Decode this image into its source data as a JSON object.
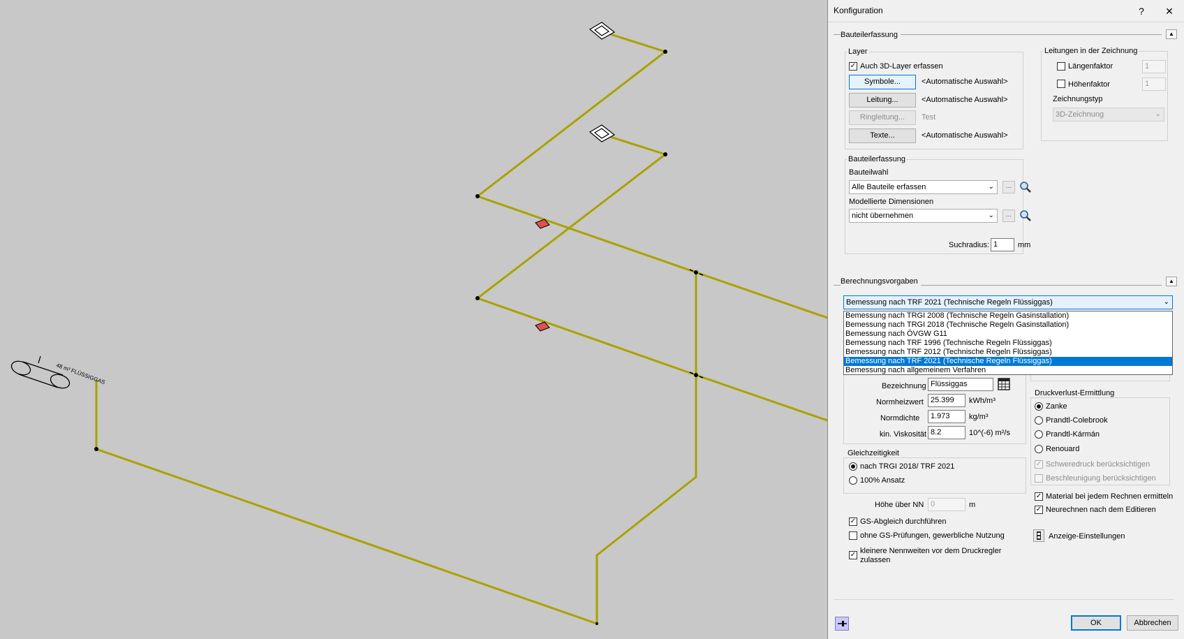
{
  "colors": {
    "pipe": "#a8a200",
    "accent": "#0078d7"
  },
  "canvas": {
    "labels": {
      "tank_label": "48 m³ FLÜSSIGGAS"
    }
  },
  "dialog": {
    "title": "Konfiguration",
    "help_label": "?",
    "close_label": "✕",
    "bauteilerfassung_section": {
      "heading": "Bauteilerfassung",
      "layer_group": {
        "label": "Layer",
        "check_3d_label": "Auch 3D-Layer erfassen",
        "check_3d_checked": true,
        "rows": [
          {
            "button": "Symbole...",
            "value": "<Automatische Auswahl>"
          },
          {
            "button": "Leitung...",
            "value": "<Automatische Auswahl>"
          },
          {
            "button": "Ringleitung...",
            "value": "Test"
          },
          {
            "button": "Texte...",
            "value": "<Automatische Auswahl>"
          }
        ]
      },
      "leitungen_group": {
        "label": "Leitungen in der Zeichnung",
        "laengenfaktor_label": "Längenfaktor",
        "laengenfaktor_value": "1",
        "hoehenfaktor_label": "Höhenfaktor",
        "hoehenfaktor_value": "1",
        "zeichnungstyp_label": "Zeichnungstyp",
        "zeichnungstyp_value": "3D-Zeichnung"
      },
      "erfassung_group": {
        "label": "Bauteilerfassung",
        "bauteilwahl_label": "Bauteilwahl",
        "bauteilwahl_value": "Alle Bauteile erfassen",
        "dimensionen_label": "Modellierte Dimensionen",
        "dimensionen_value": "nicht übernehmen",
        "ellipsis_label": "...",
        "suchradius_label": "Suchradius:",
        "suchradius_value": "1",
        "suchradius_unit": "mm"
      }
    },
    "berechnung_section": {
      "heading": "Berechnungsvorgaben",
      "selected": "Bemessung nach TRF 2021 (Technische Regeln Flüssiggas)",
      "options": [
        "Bemessung nach TRGI 2008 (Technische Regeln Gasinstallation)",
        "Bemessung nach TRGI 2018 (Technische Regeln Gasinstallation)",
        "Bemessung nach ÖVGW G11",
        "Bemessung nach TRF 1996 (Technische Regeln Flüssiggas)",
        "Bemessung nach TRF 2012 (Technische Regeln Flüssiggas)",
        "Bemessung nach TRF 2021 (Technische Regeln Flüssiggas)",
        "Bemessung nach allgemeinem Verfahren"
      ],
      "selected_index": 5,
      "gas": {
        "bezeichnung_label": "Bezeichnung",
        "bezeichnung_value": "Flüssiggas",
        "normheizwert_label": "Normheizwert",
        "normheizwert_value": "25.399",
        "normheizwert_unit": "kWh/m³",
        "normdichte_label": "Normdichte",
        "normdichte_value": "1.973",
        "normdichte_unit": "kg/m³",
        "viskositaet_label": "kin. Viskosität",
        "viskositaet_value": "8.2",
        "viskositaet_unit": "10^(-6) m²/s"
      },
      "gleichzeitigkeit": {
        "label": "Gleichzeitigkeit",
        "opt1": "nach TRGI 2018/ TRF 2021",
        "opt2": "100% Ansatz"
      },
      "hoehe_label": "Höhe über NN",
      "hoehe_value": "0",
      "hoehe_unit": "m",
      "gs_abgleich_label": "GS-Abgleich durchführen",
      "ohne_gs_label": "ohne GS-Prüfungen, gewerbliche Nutzung",
      "kleinere_label_1": "kleinere Nennweiten vor dem Druckregler",
      "kleinere_label_2": "zulassen",
      "druckverlust": {
        "label": "Druckverlust-Ermittlung",
        "options": [
          "Zanke",
          "Prandtl-Colebrook",
          "Prandtl-Kármán",
          "Renouard"
        ],
        "schweredruck_label": "Schweredruck berücksichtigen",
        "beschleunigung_label": "Beschleunigung berücksichtigen"
      },
      "material_label": "Material bei jedem Rechnen ermitteln",
      "neurechnen_label": "Neurechnen nach dem Editieren",
      "anzeige_label": "Anzeige-Einstellungen"
    },
    "ok_label": "OK",
    "cancel_label": "Abbrechen"
  }
}
